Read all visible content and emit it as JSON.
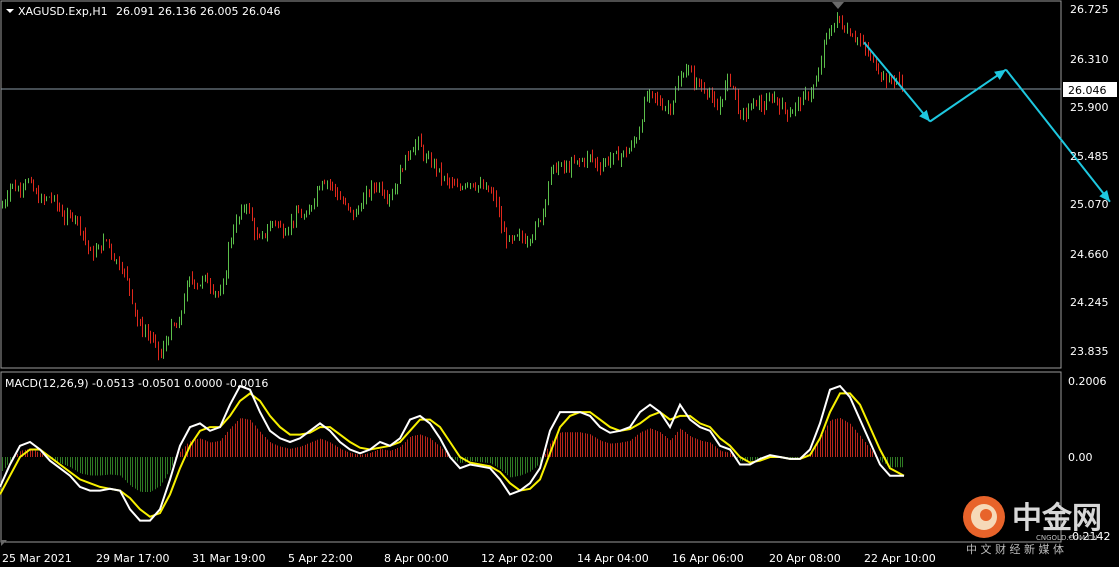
{
  "symbol_label": "XAGUSD.Exp,H1",
  "ohlc_label": "26.091 26.136 26.005 26.046",
  "price_axis": [
    "26.725",
    "26.310",
    "25.900",
    "25.485",
    "25.070",
    "24.660",
    "24.245",
    "23.835"
  ],
  "current_price_label": "26.046",
  "macd_label": "MACD(12,26,9) -0.0513 -0.0501 0.0000 -0.0016",
  "macd_axis": {
    "top": "0.2006",
    "mid": "0.00",
    "bottom": "-0.2142"
  },
  "time_axis": [
    "25 Mar 2021",
    "29 Mar 17:00",
    "31 Mar 19:00",
    "5 Apr 22:00",
    "8 Apr 00:00",
    "12 Apr 02:00",
    "14 Apr 04:00",
    "16 Apr 06:00",
    "20 Apr 08:00",
    "22 Apr 10:00"
  ],
  "watermark": {
    "brand": "中金网",
    "url": "CNGOLD.COM.CN",
    "tagline": "中 文 财 经 新 媒 体"
  },
  "colors": {
    "bull": "#5bbf4a",
    "bear": "#e0281c",
    "macd_line": "#ffffff",
    "signal_line": "#f7f000",
    "hist_pos": "#b8261c",
    "hist_neg": "#2f7a24",
    "arrow": "#1ec8e0",
    "grid_border": "#9a9a9a"
  },
  "chart_data": {
    "type": "candlestick",
    "symbol": "XAGUSD",
    "timeframe": "H1",
    "price_range": [
      23.7,
      26.8
    ],
    "price_path": [
      [
        0,
        25.05
      ],
      [
        4,
        25.1
      ],
      [
        10,
        25.25
      ],
      [
        18,
        25.2
      ],
      [
        26,
        25.3
      ],
      [
        34,
        25.18
      ],
      [
        42,
        25.1
      ],
      [
        50,
        25.15
      ],
      [
        58,
        25.05
      ],
      [
        66,
        24.95
      ],
      [
        74,
        25.0
      ],
      [
        82,
        24.85
      ],
      [
        90,
        24.65
      ],
      [
        98,
        24.7
      ],
      [
        106,
        24.78
      ],
      [
        114,
        24.62
      ],
      [
        122,
        24.55
      ],
      [
        130,
        24.35
      ],
      [
        138,
        24.05
      ],
      [
        146,
        24.0
      ],
      [
        154,
        23.9
      ],
      [
        160,
        23.78
      ],
      [
        166,
        23.92
      ],
      [
        172,
        24.05
      ],
      [
        178,
        24.02
      ],
      [
        184,
        24.3
      ],
      [
        190,
        24.45
      ],
      [
        198,
        24.4
      ],
      [
        206,
        24.45
      ],
      [
        214,
        24.35
      ],
      [
        222,
        24.3
      ],
      [
        228,
        24.7
      ],
      [
        234,
        24.9
      ],
      [
        240,
        24.98
      ],
      [
        246,
        25.1
      ],
      [
        252,
        24.92
      ],
      [
        258,
        24.75
      ],
      [
        266,
        24.85
      ],
      [
        274,
        24.95
      ],
      [
        282,
        24.85
      ],
      [
        290,
        24.92
      ],
      [
        298,
        25.0
      ],
      [
        306,
        24.95
      ],
      [
        314,
        25.15
      ],
      [
        322,
        25.3
      ],
      [
        330,
        25.25
      ],
      [
        338,
        25.15
      ],
      [
        346,
        25.05
      ],
      [
        354,
        24.98
      ],
      [
        362,
        25.1
      ],
      [
        370,
        25.2
      ],
      [
        378,
        25.25
      ],
      [
        386,
        25.15
      ],
      [
        394,
        25.2
      ],
      [
        402,
        25.4
      ],
      [
        410,
        25.55
      ],
      [
        418,
        25.6
      ],
      [
        426,
        25.45
      ],
      [
        434,
        25.42
      ],
      [
        442,
        25.3
      ],
      [
        450,
        25.25
      ],
      [
        458,
        25.2
      ],
      [
        466,
        25.28
      ],
      [
        474,
        25.25
      ],
      [
        482,
        25.22
      ],
      [
        490,
        25.18
      ],
      [
        496,
        25.1
      ],
      [
        502,
        24.85
      ],
      [
        510,
        24.75
      ],
      [
        518,
        24.8
      ],
      [
        526,
        24.78
      ],
      [
        534,
        24.85
      ],
      [
        542,
        25.0
      ],
      [
        550,
        25.35
      ],
      [
        558,
        25.4
      ],
      [
        566,
        25.38
      ],
      [
        574,
        25.42
      ],
      [
        582,
        25.45
      ],
      [
        590,
        25.48
      ],
      [
        598,
        25.4
      ],
      [
        606,
        25.45
      ],
      [
        614,
        25.48
      ],
      [
        622,
        25.5
      ],
      [
        630,
        25.55
      ],
      [
        638,
        25.68
      ],
      [
        646,
        26.0
      ],
      [
        654,
        25.98
      ],
      [
        662,
        25.92
      ],
      [
        670,
        25.9
      ],
      [
        678,
        26.1
      ],
      [
        686,
        26.25
      ],
      [
        694,
        26.12
      ],
      [
        700,
        26.08
      ],
      [
        708,
        26.05
      ],
      [
        716,
        25.85
      ],
      [
        722,
        26.0
      ],
      [
        728,
        26.15
      ],
      [
        734,
        26.05
      ],
      [
        740,
        25.8
      ],
      [
        748,
        25.88
      ],
      [
        756,
        25.95
      ],
      [
        764,
        25.9
      ],
      [
        772,
        26.0
      ],
      [
        780,
        25.92
      ],
      [
        788,
        25.85
      ],
      [
        796,
        25.92
      ],
      [
        804,
        25.98
      ],
      [
        812,
        26.05
      ],
      [
        818,
        26.15
      ],
      [
        824,
        26.45
      ],
      [
        830,
        26.55
      ],
      [
        836,
        26.65
      ],
      [
        842,
        26.6
      ],
      [
        848,
        26.55
      ],
      [
        856,
        26.5
      ],
      [
        864,
        26.4
      ],
      [
        872,
        26.3
      ],
      [
        880,
        26.2
      ],
      [
        888,
        26.12
      ],
      [
        896,
        26.15
      ],
      [
        904,
        26.05
      ]
    ],
    "forecast_arrows": [
      {
        "from": [
          864,
          26.45
        ],
        "to": [
          930,
          25.78
        ]
      },
      {
        "from": [
          930,
          25.78
        ],
        "to": [
          1006,
          26.22
        ]
      },
      {
        "from": [
          1006,
          26.22
        ],
        "to": [
          1110,
          25.1
        ]
      }
    ],
    "macd_range": [
      -0.2142,
      0.2006
    ],
    "macd_line": [
      [
        0,
        -0.08
      ],
      [
        10,
        -0.02
      ],
      [
        20,
        0.03
      ],
      [
        30,
        0.04
      ],
      [
        40,
        0.02
      ],
      [
        50,
        -0.01
      ],
      [
        60,
        -0.03
      ],
      [
        70,
        -0.05
      ],
      [
        80,
        -0.08
      ],
      [
        90,
        -0.09
      ],
      [
        100,
        -0.09
      ],
      [
        110,
        -0.085
      ],
      [
        120,
        -0.09
      ],
      [
        130,
        -0.14
      ],
      [
        140,
        -0.17
      ],
      [
        150,
        -0.17
      ],
      [
        160,
        -0.14
      ],
      [
        170,
        -0.06
      ],
      [
        180,
        0.03
      ],
      [
        190,
        0.08
      ],
      [
        200,
        0.09
      ],
      [
        210,
        0.07
      ],
      [
        220,
        0.08
      ],
      [
        230,
        0.14
      ],
      [
        240,
        0.19
      ],
      [
        250,
        0.18
      ],
      [
        260,
        0.12
      ],
      [
        270,
        0.07
      ],
      [
        280,
        0.05
      ],
      [
        290,
        0.04
      ],
      [
        300,
        0.05
      ],
      [
        310,
        0.07
      ],
      [
        320,
        0.09
      ],
      [
        330,
        0.07
      ],
      [
        340,
        0.04
      ],
      [
        350,
        0.02
      ],
      [
        360,
        0.01
      ],
      [
        370,
        0.02
      ],
      [
        380,
        0.04
      ],
      [
        390,
        0.03
      ],
      [
        400,
        0.05
      ],
      [
        410,
        0.1
      ],
      [
        420,
        0.11
      ],
      [
        430,
        0.09
      ],
      [
        440,
        0.05
      ],
      [
        450,
        0.0
      ],
      [
        460,
        -0.03
      ],
      [
        470,
        -0.02
      ],
      [
        480,
        -0.025
      ],
      [
        490,
        -0.03
      ],
      [
        500,
        -0.06
      ],
      [
        510,
        -0.1
      ],
      [
        520,
        -0.09
      ],
      [
        530,
        -0.07
      ],
      [
        540,
        -0.03
      ],
      [
        550,
        0.07
      ],
      [
        560,
        0.12
      ],
      [
        570,
        0.12
      ],
      [
        580,
        0.12
      ],
      [
        590,
        0.11
      ],
      [
        600,
        0.08
      ],
      [
        610,
        0.065
      ],
      [
        620,
        0.07
      ],
      [
        630,
        0.08
      ],
      [
        640,
        0.12
      ],
      [
        650,
        0.14
      ],
      [
        660,
        0.12
      ],
      [
        670,
        0.08
      ],
      [
        680,
        0.14
      ],
      [
        690,
        0.1
      ],
      [
        700,
        0.08
      ],
      [
        710,
        0.07
      ],
      [
        720,
        0.03
      ],
      [
        730,
        0.02
      ],
      [
        740,
        -0.02
      ],
      [
        750,
        -0.02
      ],
      [
        760,
        -0.005
      ],
      [
        770,
        0.005
      ],
      [
        780,
        0.0
      ],
      [
        790,
        -0.005
      ],
      [
        800,
        -0.005
      ],
      [
        810,
        0.02
      ],
      [
        820,
        0.09
      ],
      [
        830,
        0.18
      ],
      [
        840,
        0.19
      ],
      [
        850,
        0.16
      ],
      [
        860,
        0.1
      ],
      [
        870,
        0.04
      ],
      [
        880,
        -0.02
      ],
      [
        890,
        -0.05
      ],
      [
        904,
        -0.05
      ]
    ],
    "signal_line": [
      [
        0,
        -0.1
      ],
      [
        10,
        -0.05
      ],
      [
        20,
        0.0
      ],
      [
        30,
        0.02
      ],
      [
        40,
        0.02
      ],
      [
        50,
        0.0
      ],
      [
        60,
        -0.02
      ],
      [
        70,
        -0.04
      ],
      [
        80,
        -0.06
      ],
      [
        90,
        -0.07
      ],
      [
        100,
        -0.08
      ],
      [
        110,
        -0.085
      ],
      [
        120,
        -0.09
      ],
      [
        130,
        -0.11
      ],
      [
        140,
        -0.14
      ],
      [
        150,
        -0.16
      ],
      [
        160,
        -0.15
      ],
      [
        170,
        -0.1
      ],
      [
        180,
        -0.03
      ],
      [
        190,
        0.03
      ],
      [
        200,
        0.07
      ],
      [
        210,
        0.08
      ],
      [
        220,
        0.08
      ],
      [
        230,
        0.11
      ],
      [
        240,
        0.15
      ],
      [
        250,
        0.17
      ],
      [
        260,
        0.15
      ],
      [
        270,
        0.11
      ],
      [
        280,
        0.08
      ],
      [
        290,
        0.06
      ],
      [
        300,
        0.06
      ],
      [
        310,
        0.065
      ],
      [
        320,
        0.08
      ],
      [
        330,
        0.08
      ],
      [
        340,
        0.06
      ],
      [
        350,
        0.04
      ],
      [
        360,
        0.025
      ],
      [
        370,
        0.02
      ],
      [
        380,
        0.025
      ],
      [
        390,
        0.03
      ],
      [
        400,
        0.04
      ],
      [
        410,
        0.07
      ],
      [
        420,
        0.1
      ],
      [
        430,
        0.1
      ],
      [
        440,
        0.08
      ],
      [
        450,
        0.04
      ],
      [
        460,
        0.0
      ],
      [
        470,
        -0.015
      ],
      [
        480,
        -0.02
      ],
      [
        490,
        -0.025
      ],
      [
        500,
        -0.04
      ],
      [
        510,
        -0.07
      ],
      [
        520,
        -0.09
      ],
      [
        530,
        -0.085
      ],
      [
        540,
        -0.06
      ],
      [
        550,
        0.01
      ],
      [
        560,
        0.08
      ],
      [
        570,
        0.11
      ],
      [
        580,
        0.12
      ],
      [
        590,
        0.12
      ],
      [
        600,
        0.1
      ],
      [
        610,
        0.08
      ],
      [
        620,
        0.07
      ],
      [
        630,
        0.075
      ],
      [
        640,
        0.09
      ],
      [
        650,
        0.11
      ],
      [
        660,
        0.12
      ],
      [
        670,
        0.1
      ],
      [
        680,
        0.11
      ],
      [
        690,
        0.11
      ],
      [
        700,
        0.09
      ],
      [
        710,
        0.08
      ],
      [
        720,
        0.05
      ],
      [
        730,
        0.03
      ],
      [
        740,
        0.0
      ],
      [
        750,
        -0.015
      ],
      [
        760,
        -0.01
      ],
      [
        770,
        0.0
      ],
      [
        780,
        0.0
      ],
      [
        790,
        -0.005
      ],
      [
        800,
        -0.005
      ],
      [
        810,
        0.005
      ],
      [
        820,
        0.05
      ],
      [
        830,
        0.12
      ],
      [
        840,
        0.17
      ],
      [
        850,
        0.17
      ],
      [
        860,
        0.14
      ],
      [
        870,
        0.08
      ],
      [
        880,
        0.02
      ],
      [
        890,
        -0.03
      ],
      [
        904,
        -0.05
      ]
    ]
  }
}
